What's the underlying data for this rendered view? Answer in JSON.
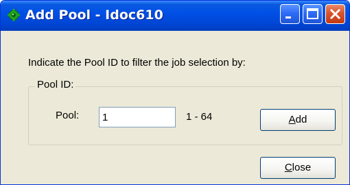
{
  "window": {
    "title": "Add Pool - Idoc610",
    "icon": "green-gear-icon",
    "controls": [
      "minimize",
      "maximize",
      "close"
    ]
  },
  "dialog": {
    "instruction": "Indicate the Pool ID to filter the job selection by:",
    "group_label": "Pool ID:",
    "pool_label": "Pool:",
    "pool_value": "1",
    "range_text": "1 - 64",
    "add_button": {
      "mnemonic": "A",
      "rest": "dd"
    },
    "close_button": {
      "mnemonic": "C",
      "rest": "lose"
    }
  },
  "colors": {
    "titlebar": "#0050e6",
    "window_bg": "#ece9d8",
    "close_button_red": "#d9542a",
    "icon_green": "#1fa31f"
  }
}
